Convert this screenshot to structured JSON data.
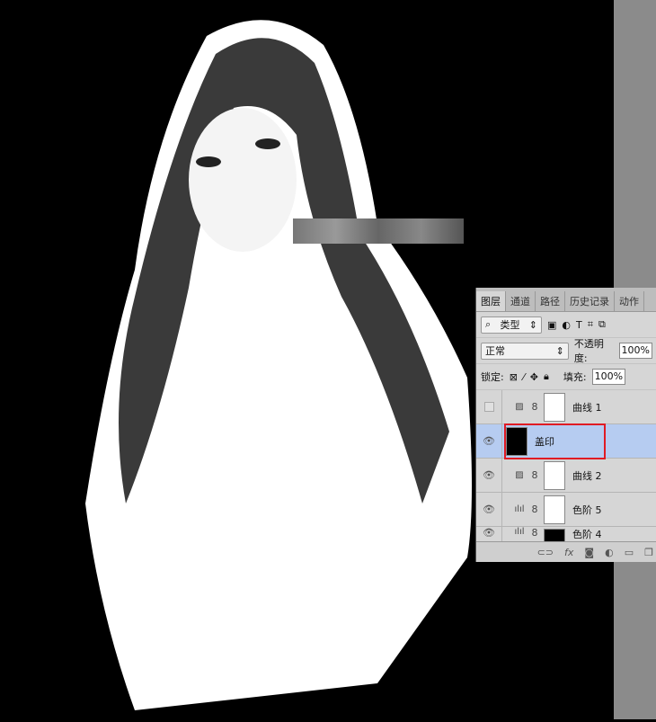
{
  "tabs": [
    {
      "label": "图层"
    },
    {
      "label": "通道"
    },
    {
      "label": "路径"
    },
    {
      "label": "历史记录"
    },
    {
      "label": "动作"
    }
  ],
  "filter": {
    "label": "类型",
    "icons": [
      "image-filter-icon",
      "adjustment-filter-icon",
      "type-filter-icon",
      "shape-filter-icon",
      "smart-object-filter-icon"
    ]
  },
  "blend": {
    "value": "正常",
    "opacity_label": "不透明度:",
    "opacity": "100%"
  },
  "lock": {
    "label": "锁定:",
    "fill_label": "填充:",
    "fill": "100%"
  },
  "layers": [
    {
      "name": "曲线 1",
      "visible": false,
      "type": "curves"
    },
    {
      "name": "盖印",
      "visible": true,
      "type": "pixel",
      "selected": true
    },
    {
      "name": "曲线 2",
      "visible": true,
      "type": "curves"
    },
    {
      "name": "色阶 5",
      "visible": true,
      "type": "levels"
    },
    {
      "name": "色阶 4",
      "visible": true,
      "type": "levels"
    }
  ],
  "colors": {
    "selection": "#b6ccf1",
    "highlight": "#e01b24"
  }
}
